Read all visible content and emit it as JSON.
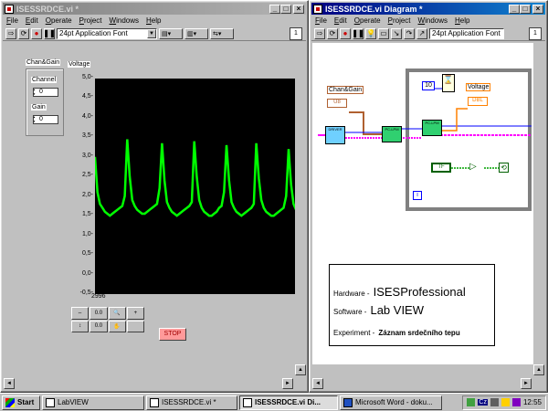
{
  "front": {
    "title": "ISESSRDCE.vi *",
    "menu": [
      "File",
      "Edit",
      "Operate",
      "Project",
      "Windows",
      "Help"
    ],
    "font": "24pt Application Font",
    "help_num": "1",
    "cluster_label": "Chan&Gain",
    "channel_label": "Channel",
    "channel_value": "0",
    "gain_label": "Gain",
    "gain_value": "0",
    "chart_label": "Voltage",
    "stop_label": "STOP",
    "palette": [
      "⇔",
      "0.0",
      "🔍",
      "+",
      "↕",
      "0.0",
      "✋",
      ""
    ]
  },
  "diagram": {
    "title": "ISESSRDCE.vi Diagram *",
    "menu": [
      "File",
      "Edit",
      "Operate",
      "Project",
      "Windows",
      "Help"
    ],
    "font": "24pt Application Font",
    "help_num": "1",
    "node_changain": "Chan&Gain",
    "node_u8": "U8",
    "node_voltage": "Voltage",
    "node_dbl": "DBL",
    "node_const10": "10",
    "node_tf": "TF",
    "node_iter": "i",
    "node_driver": "DRIVER",
    "node_pc1": "PC-LPM",
    "node_pc2": "PC-LPM",
    "info": {
      "hardware_key": "Hardware -",
      "hardware_val": "ISESProfessional",
      "software_key": "Software -",
      "software_val": "Lab VIEW",
      "experiment_key": "Experiment -",
      "experiment_val": "Záznam srdečního tepu"
    }
  },
  "taskbar": {
    "start": "Start",
    "items": [
      "LabVIEW",
      "ISESSRDCE.vi *",
      "ISESSRDCE.vi Di...",
      "Microsoft Word - doku..."
    ],
    "tray_lang": "Cz",
    "clock": "12:55"
  },
  "chart_data": {
    "type": "line",
    "title": "",
    "xlabel": "",
    "ylabel": "",
    "ylim": [
      -0.5,
      5.0
    ],
    "yticks": [
      "5,0-",
      "4,5-",
      "4,0-",
      "3,5-",
      "3,0-",
      "2,5-",
      "2,0-",
      "1,5-",
      "1,0-",
      "0,5-",
      "0,0-",
      "-0,5-"
    ],
    "xtick_start": "2996",
    "color": "#00ff00",
    "series": [
      {
        "values": [
          3.0,
          2.1,
          1.8,
          1.7,
          1.6,
          1.55,
          1.5,
          1.55,
          1.6,
          1.65,
          1.7,
          1.75,
          2.0,
          3.45,
          2.5,
          1.9,
          1.75,
          1.65,
          1.6,
          1.55,
          1.55,
          1.6,
          1.65,
          1.7,
          1.75,
          1.8,
          2.2,
          3.35,
          2.4,
          1.85,
          1.7,
          1.6,
          1.55,
          1.5,
          1.55,
          1.6,
          1.65,
          1.7,
          1.75,
          1.85,
          3.4,
          2.5,
          1.9,
          1.7,
          1.6,
          1.55,
          1.5,
          1.5,
          1.55,
          1.6,
          1.7,
          1.75,
          2.1,
          3.3,
          2.4,
          1.85,
          1.7,
          1.6,
          1.55,
          1.5,
          1.55,
          1.6,
          1.65,
          1.7,
          1.8,
          3.35,
          2.45,
          1.9,
          1.7,
          1.6,
          1.55,
          1.5,
          1.5,
          1.55,
          1.6,
          1.65,
          1.7,
          2.0,
          3.2,
          2.3,
          1.8,
          1.65,
          1.55,
          1.5,
          1.45,
          1.5
        ]
      }
    ]
  }
}
